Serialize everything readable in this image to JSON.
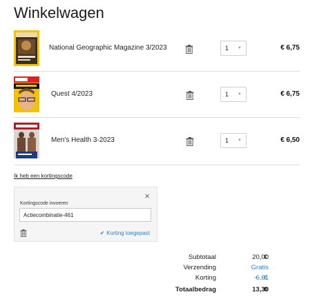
{
  "page": {
    "title": "Winkelwagen"
  },
  "cart": {
    "items": [
      {
        "name": "National Geographic Magazine 3/2023",
        "quantity": "1",
        "price": "€ 6,75",
        "thumbnail_icon": "national-geographic-cover"
      },
      {
        "name": "Quest 4/2023",
        "quantity": "1",
        "price": "€ 6,75",
        "thumbnail_icon": "quest-cover"
      },
      {
        "name": "Men's Health 3-2023",
        "quantity": "1",
        "price": "€ 6,50",
        "thumbnail_icon": "mens-health-cover"
      }
    ]
  },
  "discount": {
    "link_label": "Ik heb een kortingscode",
    "field_label": "Kortingscode invoeren",
    "code_value": "Actiecombinatie-461",
    "applied_label": "Korting toegepast",
    "close_icon": "×"
  },
  "summary": {
    "subtotal_label": "Subtotaal",
    "subtotal_currency": "€",
    "subtotal_value": "20,00",
    "shipping_label": "Verzending",
    "shipping_value": "Gratis",
    "discount_label": "Korting",
    "discount_minus": "−",
    "discount_currency": "€",
    "discount_value": "6,61",
    "total_label": "Totaalbedrag",
    "total_currency": "€",
    "total_value": "13,39"
  },
  "colors": {
    "accent": "#2a7fd0",
    "divider": "#dcdcdc",
    "panel_bg": "#f5f5f5"
  }
}
